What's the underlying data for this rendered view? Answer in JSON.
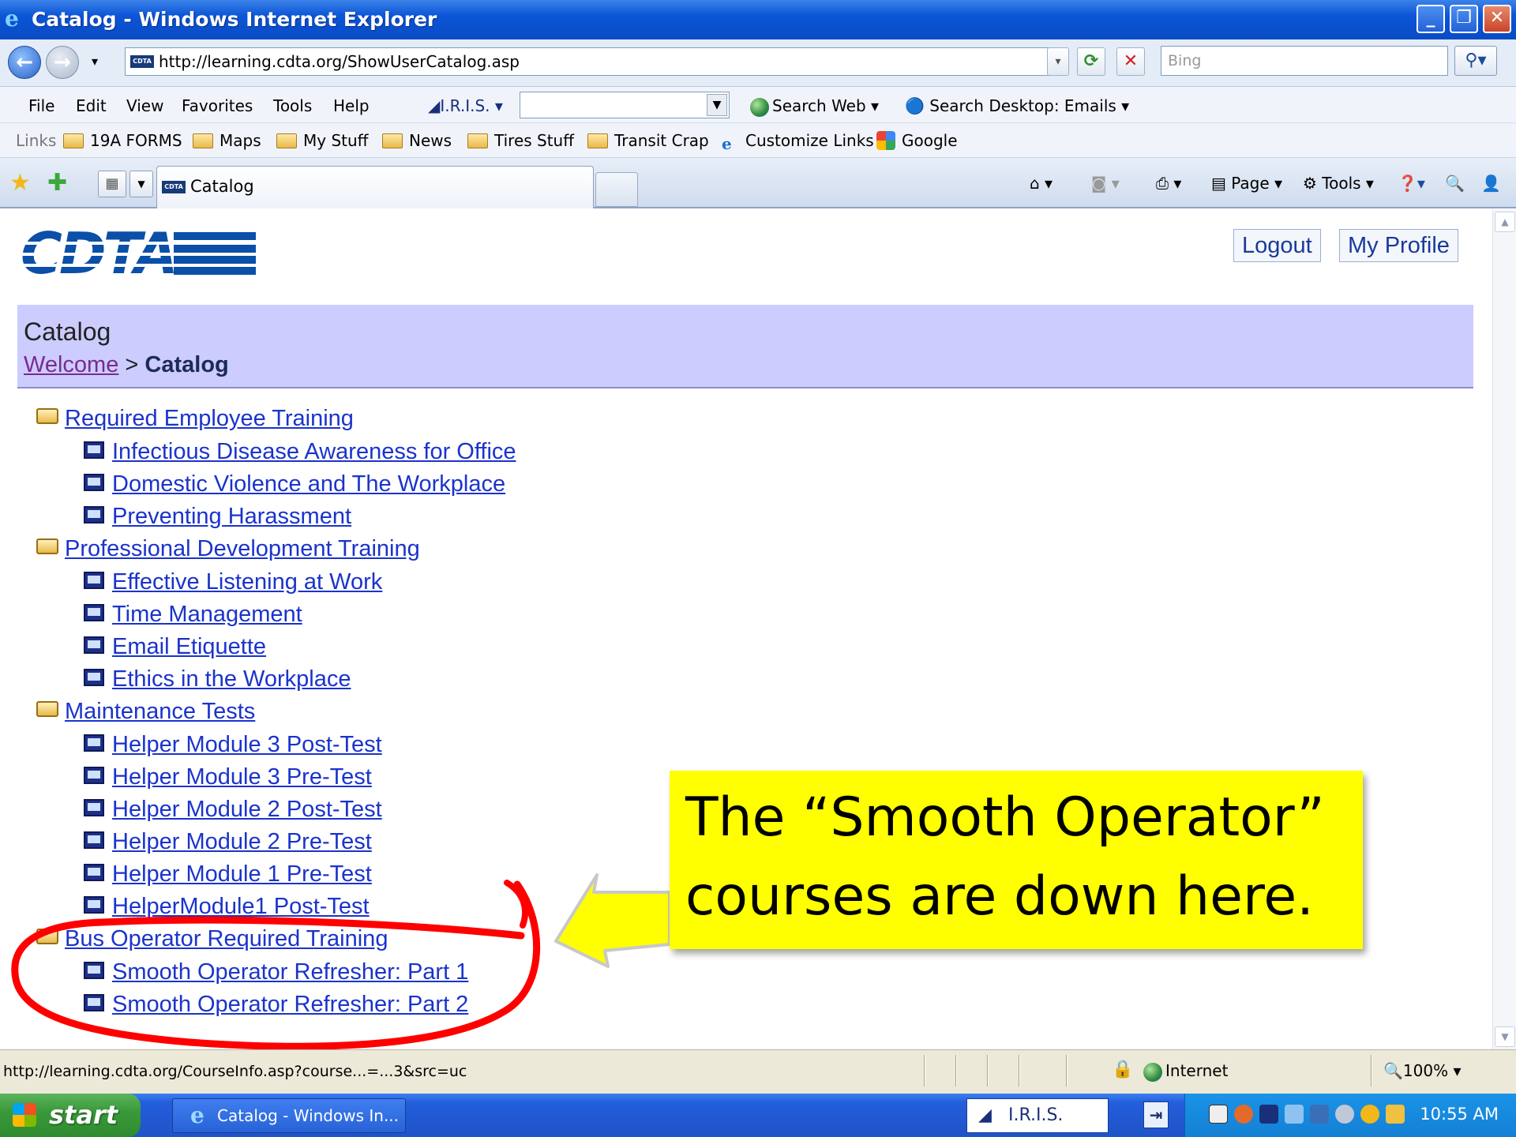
{
  "window": {
    "title": "Catalog - Windows Internet Explorer"
  },
  "address": {
    "url": "http://learning.cdta.org/ShowUserCatalog.asp",
    "search_placeholder": "Bing"
  },
  "menu": {
    "items": [
      "File",
      "Edit",
      "View",
      "Favorites",
      "Tools",
      "Help"
    ],
    "iris_label": "I.R.I.S.",
    "search_web": "Search Web",
    "search_desktop": "Search Desktop: Emails"
  },
  "links_bar": {
    "label": "Links",
    "items": [
      "19A FORMS",
      "Maps",
      "My Stuff",
      "News",
      "Tires Stuff",
      "Transit Crap",
      "Customize Links",
      "Google"
    ]
  },
  "tab": {
    "title": "Catalog",
    "page_menu": "Page",
    "tools_menu": "Tools"
  },
  "page": {
    "logo_text": "CDTA",
    "logout": "Logout",
    "my_profile": "My Profile",
    "heading": "Catalog",
    "breadcrumb_home": "Welcome",
    "breadcrumb_sep": ">",
    "breadcrumb_current": "Catalog",
    "categories": [
      {
        "name": "Required Employee Training",
        "courses": [
          "Infectious Disease Awareness for Office",
          "Domestic Violence and The Workplace",
          "Preventing Harassment"
        ]
      },
      {
        "name": "Professional Development Training",
        "courses": [
          "Effective Listening at Work",
          "Time Management",
          "Email Etiquette",
          "Ethics in the Workplace"
        ]
      },
      {
        "name": "Maintenance Tests",
        "courses": [
          "Helper Module 3 Post-Test",
          "Helper Module 3 Pre-Test",
          "Helper Module 2 Post-Test",
          "Helper Module 2 Pre-Test",
          "Helper Module 1 Pre-Test",
          "HelperModule1 Post-Test"
        ]
      },
      {
        "name": "Bus Operator Required Training",
        "courses": [
          "Smooth Operator Refresher: Part 1",
          "Smooth Operator Refresher: Part 2"
        ]
      }
    ]
  },
  "callout": {
    "line1": "The “Smooth Operator”",
    "line2": "courses are down here."
  },
  "status": {
    "url": "http://learning.cdta.org/CourseInfo.asp?course...=...3&src=uc",
    "zone": "Internet",
    "zoom": "100%"
  },
  "taskbar": {
    "start": "start",
    "item": "Catalog - Windows In...",
    "iris": "I.R.I.S.",
    "time": "10:55 AM"
  },
  "colors": {
    "header_bg": "#ccccff",
    "link": "#1a33cc",
    "callout_bg": "#ffff00",
    "annotation": "#ff0000"
  }
}
